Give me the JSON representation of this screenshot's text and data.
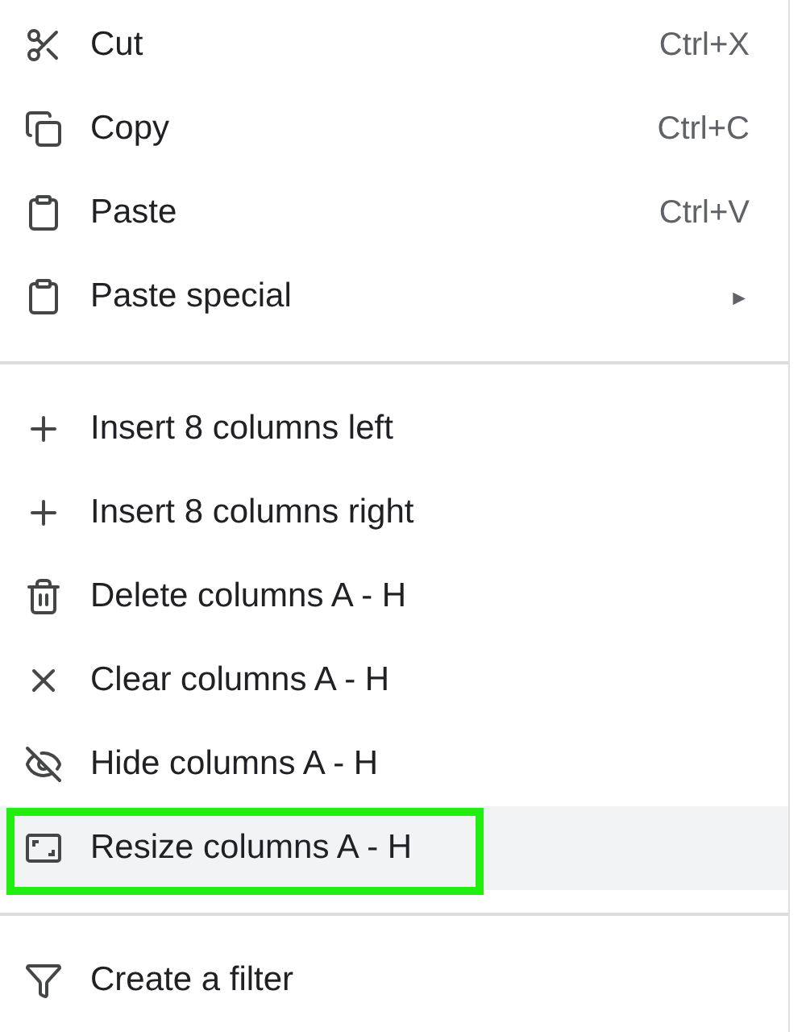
{
  "menu": {
    "sections": [
      {
        "items": [
          {
            "label": "Cut",
            "shortcut": "Ctrl+X",
            "selected": false
          },
          {
            "label": "Copy",
            "shortcut": "Ctrl+C",
            "selected": false
          },
          {
            "label": "Paste",
            "shortcut": "Ctrl+V",
            "selected": false
          },
          {
            "label": "Paste special",
            "submenu": "►",
            "selected": false
          }
        ]
      },
      {
        "items": [
          {
            "label": "Insert 8 columns left",
            "selected": false
          },
          {
            "label": "Insert 8 columns right",
            "selected": false
          },
          {
            "label": "Delete columns A - H",
            "selected": false
          },
          {
            "label": "Clear columns A - H",
            "selected": false
          },
          {
            "label": "Hide columns A - H",
            "selected": false
          },
          {
            "label": "Resize columns A - H",
            "selected": true
          }
        ]
      },
      {
        "items": [
          {
            "label": "Create a filter",
            "selected": false
          }
        ]
      }
    ]
  }
}
